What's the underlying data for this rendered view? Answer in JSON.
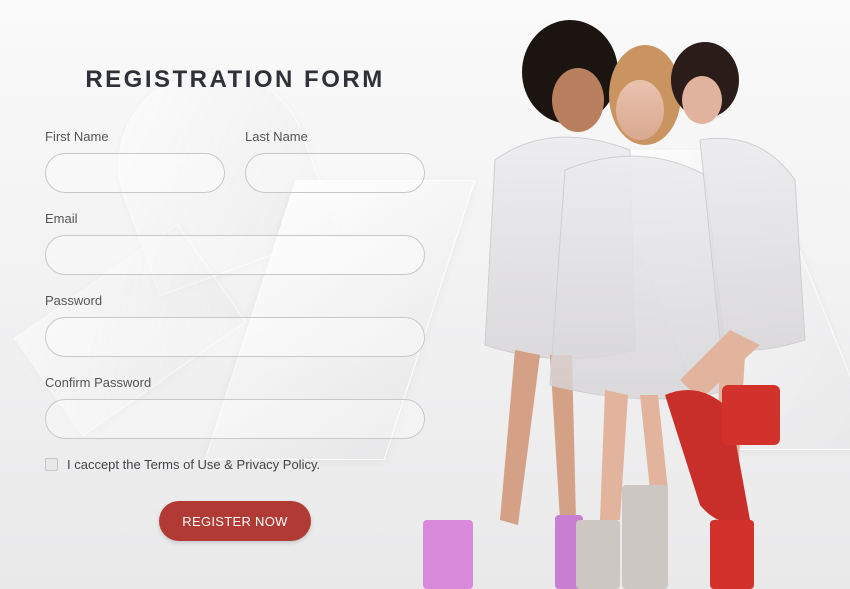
{
  "form": {
    "title": "REGISTRATION FORM",
    "first_name_label": "First Name",
    "last_name_label": "Last Name",
    "email_label": "Email",
    "password_label": "Password",
    "confirm_password_label": "Confirm Password",
    "first_name_value": "",
    "last_name_value": "",
    "email_value": "",
    "password_value": "",
    "confirm_password_value": "",
    "terms_text": "I caccept the Terms of Use & Privacy Policy.",
    "terms_checked": false,
    "submit_label": "REGISTER NOW"
  },
  "colors": {
    "accent": "#b13a34",
    "title": "#2f3138",
    "boot_pink": "#d989d9",
    "boot_grey": "#cdc7c3",
    "boot_red": "#d3322c"
  },
  "hero": {
    "description_icon": "three-women-raincoats-rain-boots-photo"
  }
}
